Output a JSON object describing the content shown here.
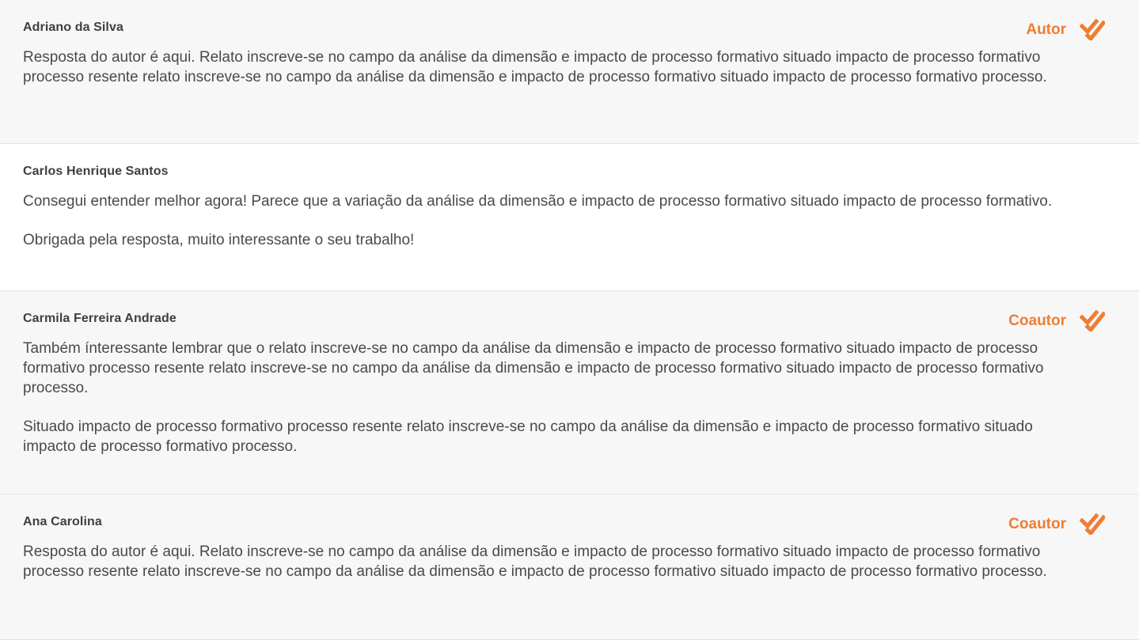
{
  "accent_color": "#ef7d33",
  "comments": [
    {
      "author": "Adriano da Silva",
      "role": "Autor",
      "verified_icon": "double-check-icon",
      "paragraphs": [
        "Resposta do autor é aqui. Relato inscreve-se no campo da análise da dimensão e impacto de processo formativo situado impacto de processo formativo processo resente relato inscreve-se no campo da análise da dimensão e impacto de processo formativo situado impacto de processo formativo processo."
      ]
    },
    {
      "author": "Carlos Henrique Santos",
      "role": "",
      "paragraphs": [
        "Consegui entender melhor agora! Parece que a variação da análise da dimensão e impacto de processo formativo situado impacto de processo formativo.",
        "Obrigada pela resposta, muito interessante o seu trabalho!"
      ]
    },
    {
      "author": "Carmila Ferreira Andrade",
      "role": "Coautor",
      "verified_icon": "double-check-icon",
      "paragraphs": [
        "Também ínteressante lembrar que o relato inscreve-se no campo da análise da dimensão e impacto de processo formativo situado impacto de processo formativo processo resente relato inscreve-se no campo da análise da dimensão e impacto de processo formativo situado impacto de processo formativo processo.",
        "Situado impacto de processo formativo processo resente relato inscreve-se no campo da análise da dimensão e impacto de processo formativo situado impacto de processo formativo processo."
      ]
    },
    {
      "author": "Ana Carolina",
      "role": "Coautor",
      "verified_icon": "double-check-icon",
      "paragraphs": [
        "Resposta do autor é aqui. Relato inscreve-se no campo da análise da dimensão e impacto de processo formativo situado impacto de processo formativo processo resente relato inscreve-se no campo da análise da dimensão e impacto de processo formativo situado impacto de processo formativo processo."
      ]
    }
  ]
}
